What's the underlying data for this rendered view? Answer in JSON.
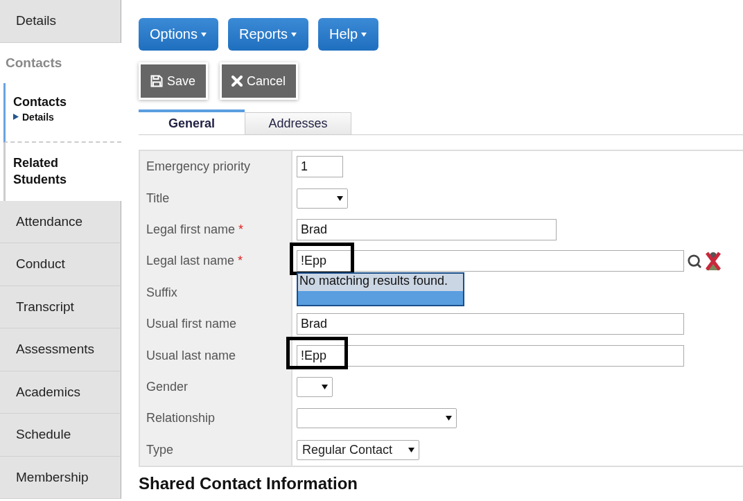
{
  "sidebar": [
    {
      "kind": "tab",
      "label": "Details"
    },
    {
      "kind": "heading",
      "label": "Contacts"
    },
    {
      "kind": "node",
      "label": "Contacts",
      "selected": true,
      "children": [
        {
          "label": "Details"
        }
      ]
    },
    {
      "kind": "node",
      "label": "Related Students",
      "selected": false
    },
    {
      "kind": "tab",
      "label": "Attendance"
    },
    {
      "kind": "tab",
      "label": "Conduct"
    },
    {
      "kind": "tab",
      "label": "Transcript"
    },
    {
      "kind": "tab",
      "label": "Assessments"
    },
    {
      "kind": "tab",
      "label": "Academics"
    },
    {
      "kind": "tab",
      "label": "Schedule"
    },
    {
      "kind": "tab",
      "label": "Membership"
    }
  ],
  "menu_buttons": [
    "Options",
    "Reports",
    "Help"
  ],
  "action_buttons": [
    {
      "kind": "save",
      "label": "Save"
    },
    {
      "kind": "cancel",
      "label": "Cancel"
    }
  ],
  "tabs": [
    {
      "label": "General",
      "selected": true
    },
    {
      "label": "Addresses",
      "selected": false
    }
  ],
  "form": [
    {
      "label": "Emergency priority",
      "kind": "text",
      "value": "1"
    },
    {
      "label": "Title",
      "kind": "select"
    },
    {
      "label": "Legal first name",
      "required_mark": "*",
      "kind": "text",
      "value": "Brad"
    },
    {
      "label": "Legal last name",
      "required_mark": "*",
      "kind": "lookup",
      "value": "!Epp",
      "highlighted": true,
      "suggestion": "No matching results found."
    },
    {
      "label": "Suffix",
      "kind": "none"
    },
    {
      "label": "Usual first name",
      "kind": "text",
      "value": "Brad"
    },
    {
      "label": "Usual last name",
      "kind": "text",
      "value": "!Epp",
      "highlighted": true
    },
    {
      "label": "Gender",
      "kind": "select"
    },
    {
      "label": "Relationship",
      "kind": "select"
    },
    {
      "label": "Type",
      "kind": "select",
      "value": "Regular Contact"
    }
  ],
  "section_heading": "Shared Contact Information"
}
